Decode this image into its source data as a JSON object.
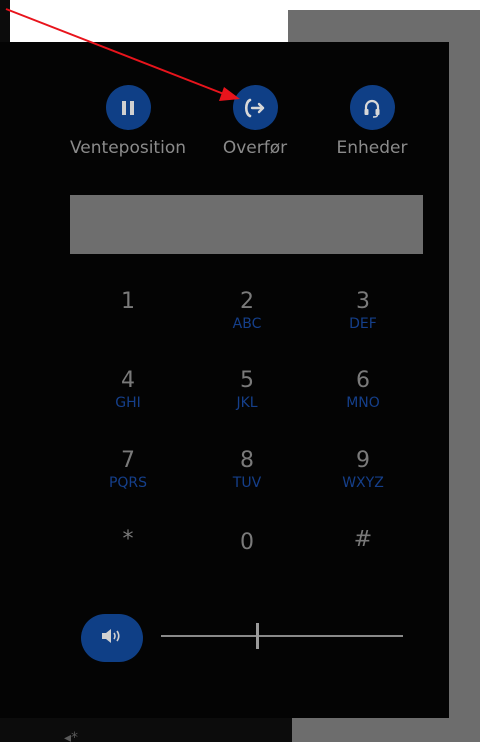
{
  "actions": [
    {
      "label": "Venteposition",
      "icon": "pause-icon"
    },
    {
      "label": "Overfør",
      "icon": "transfer-call-icon"
    },
    {
      "label": "Enheder",
      "icon": "headset-icon"
    }
  ],
  "dialpad": {
    "keys": [
      {
        "digit": "1",
        "letters": ""
      },
      {
        "digit": "2",
        "letters": "ABC"
      },
      {
        "digit": "3",
        "letters": "DEF"
      },
      {
        "digit": "4",
        "letters": "GHI"
      },
      {
        "digit": "5",
        "letters": "JKL"
      },
      {
        "digit": "6",
        "letters": "MNO"
      },
      {
        "digit": "7",
        "letters": "PQRS"
      },
      {
        "digit": "8",
        "letters": "TUV"
      },
      {
        "digit": "9",
        "letters": "WXYZ"
      },
      {
        "digit": "*",
        "letters": ""
      },
      {
        "digit": "0",
        "letters": ""
      },
      {
        "digit": "#",
        "letters": ""
      }
    ]
  },
  "volume": {
    "icon": "speaker-icon",
    "level": 0.4
  },
  "annotation": {
    "arrow_color": "#e8141c"
  },
  "colors": {
    "accent": "#0f3f86",
    "panel": "#040404",
    "letters": "#153f8a"
  }
}
